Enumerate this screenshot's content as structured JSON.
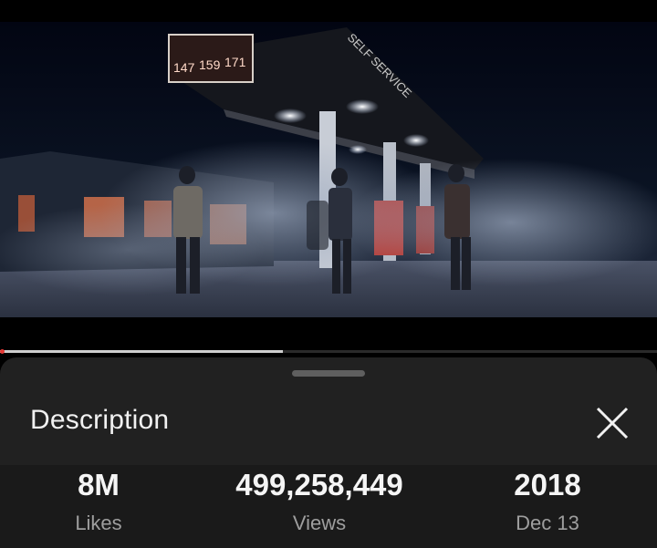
{
  "video": {
    "sign_numbers": [
      "147",
      "159",
      "171"
    ],
    "canopy_text": "SELF SERVICE",
    "progress_fraction": 0.43
  },
  "description_panel": {
    "title": "Description",
    "close_icon": "close-icon",
    "stats": {
      "likes_value": "8M",
      "likes_label": "Likes",
      "views_value": "499,258,449",
      "views_label": "Views",
      "year_value": "2018",
      "date_label": "Dec 13"
    }
  },
  "colors": {
    "progress_played": "#cfcfcf",
    "progress_dot": "#e53935",
    "sheet_background": "#212121"
  }
}
